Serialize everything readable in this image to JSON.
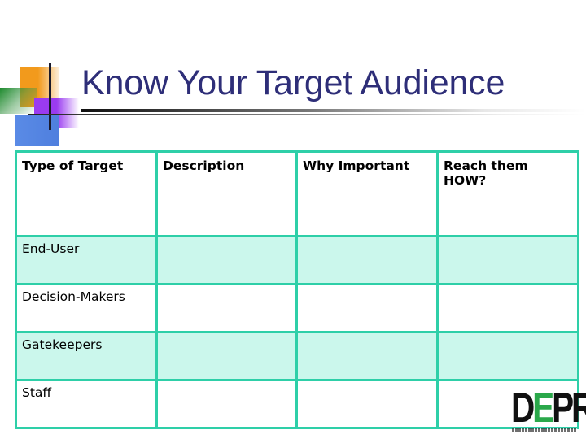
{
  "slide": {
    "title": "Know Your Target Audience"
  },
  "table": {
    "headers": [
      "Type of Target",
      "Description",
      "Why Important",
      "Reach them HOW?"
    ],
    "rows": [
      {
        "type": "End-User",
        "description": "",
        "why_important": "",
        "reach": ""
      },
      {
        "type": "Decision-Makers",
        "description": "",
        "why_important": "",
        "reach": ""
      },
      {
        "type": "Gatekeepers",
        "description": "",
        "why_important": "",
        "reach": ""
      },
      {
        "type": "Staff",
        "description": "",
        "why_important": "",
        "reach": ""
      }
    ]
  },
  "logo": {
    "letters": [
      "D",
      "E",
      "PR"
    ],
    "accent_color": "#2aa84a"
  },
  "colors": {
    "title": "#2e2e78",
    "table_border": "#2ecfa8",
    "row_shade": "#cbf7ec"
  }
}
